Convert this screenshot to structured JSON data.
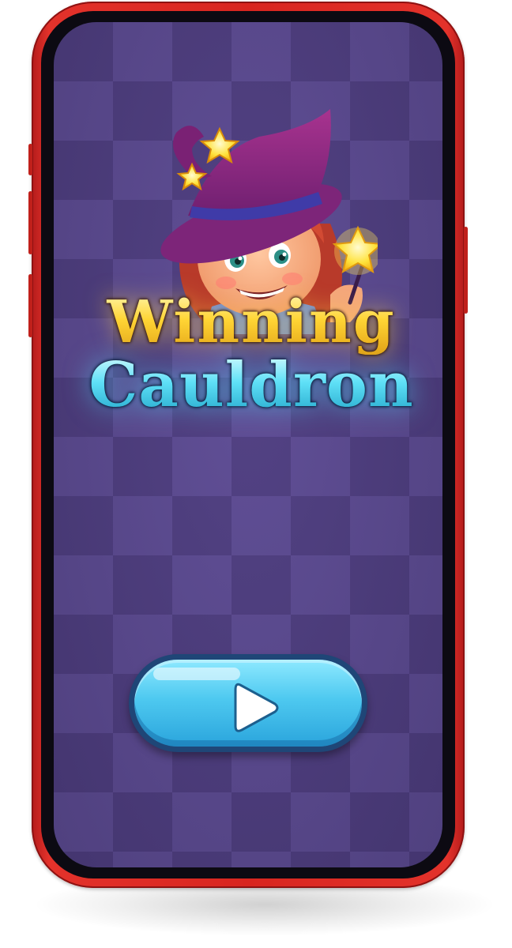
{
  "game": {
    "title_line1": "Winning",
    "title_line2": "Cauldron",
    "play_button_icon": "play-icon"
  },
  "colors": {
    "phone_frame": "#d8251f",
    "background_purple": "#4d3d7d",
    "title_gold": "#ffd535",
    "title_cyan": "#5fe0f7",
    "button_blue": "#4ec9f0"
  }
}
